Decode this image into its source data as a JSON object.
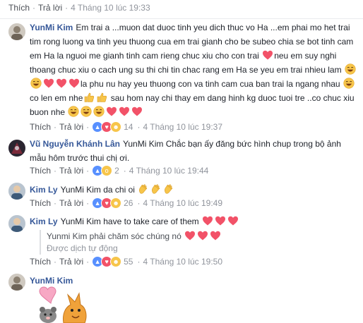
{
  "labels": {
    "like": "Thích",
    "reply": "Trả lời"
  },
  "top_action": {
    "time": "4 Tháng 10 lúc 19:33"
  },
  "comments": [
    {
      "name": "YunMi Kim",
      "segments": [
        "Em trai a ...muon dat duoc tinh yeu dich thuc vo Ha ...em phai mo het trai tim rong luong va tinh yeu thuong cua em trai gianh cho be subeo chia se bot tinh cam em Ha la nguoi me gianh tinh cam rieng chuc xiu cho con trai",
        "neu em suy nghi thoang chuc xiu o cach ung su thi chi tin chac rang em Ha se yeu em trai nhieu lam",
        "la phu nu hay yeu thuong con va tinh cam cua ban trai la ngang nhau",
        "co len em nhe",
        "sau hom nay chi thay em dang hinh kg duoc tuoi tre ..co chuc xiu buon nhe"
      ],
      "reaction_count": "14",
      "time": "4 Tháng 10 lúc 19:37"
    },
    {
      "name": "Vũ Nguyễn Khánh Lân",
      "text": "YunMi Kim Chắc bạn ấy đăng bức hình chup trong bộ ảnh mẫu hôm trước thui chị ơi.",
      "reaction_count": "2",
      "time": "4 Tháng 10 lúc 19:44"
    },
    {
      "name": "Kim Ly",
      "text": "YunMi Kim da chi oi",
      "reaction_count": "26",
      "time": "4 Tháng 10 lúc 19:49"
    },
    {
      "name": "Kim Ly",
      "text": "YunMi Kim have to take care of them",
      "translation": "Yunmi Kim phải chăm sóc chúng nó",
      "translation_note": "Được dịch tự động",
      "reaction_count": "55",
      "time": "4 Tháng 10 lúc 19:50"
    },
    {
      "name": "YunMi Kim",
      "sticker": "heart-and-animals-sticker"
    }
  ],
  "colors": {
    "link": "#365899",
    "meta": "#90949c",
    "heart": "#f25268",
    "laugh": "#f7c54a",
    "like": "#5890ff"
  }
}
